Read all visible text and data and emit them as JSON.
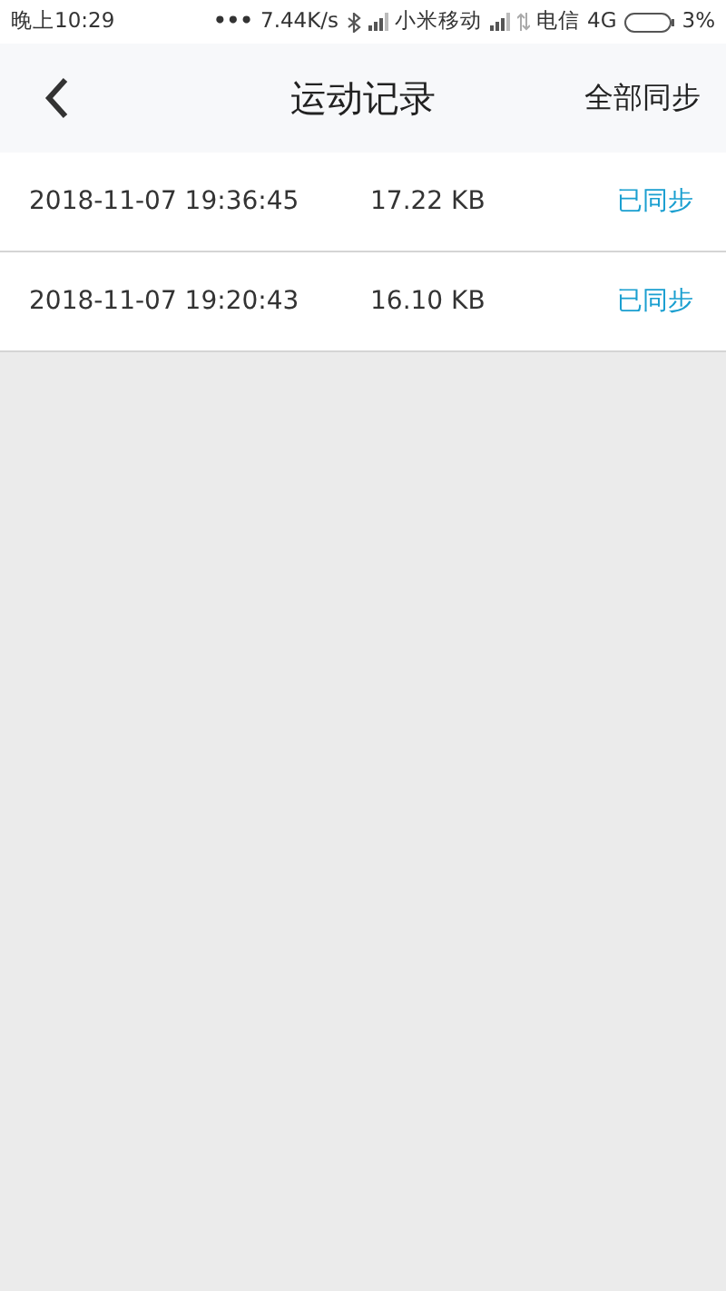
{
  "status_bar": {
    "time": "晚上10:29",
    "dots": "•••",
    "speed": "7.44K/s",
    "carrier_1": "小米移动",
    "carrier_2": "电信",
    "network": "4G",
    "battery": "3%"
  },
  "header": {
    "title": "运动记录",
    "action": "全部同步"
  },
  "records": [
    {
      "time": "2018-11-07 19:36:45",
      "size": "17.22 KB",
      "status": "已同步"
    },
    {
      "time": "2018-11-07 19:20:43",
      "size": "16.10 KB",
      "status": "已同步"
    }
  ]
}
